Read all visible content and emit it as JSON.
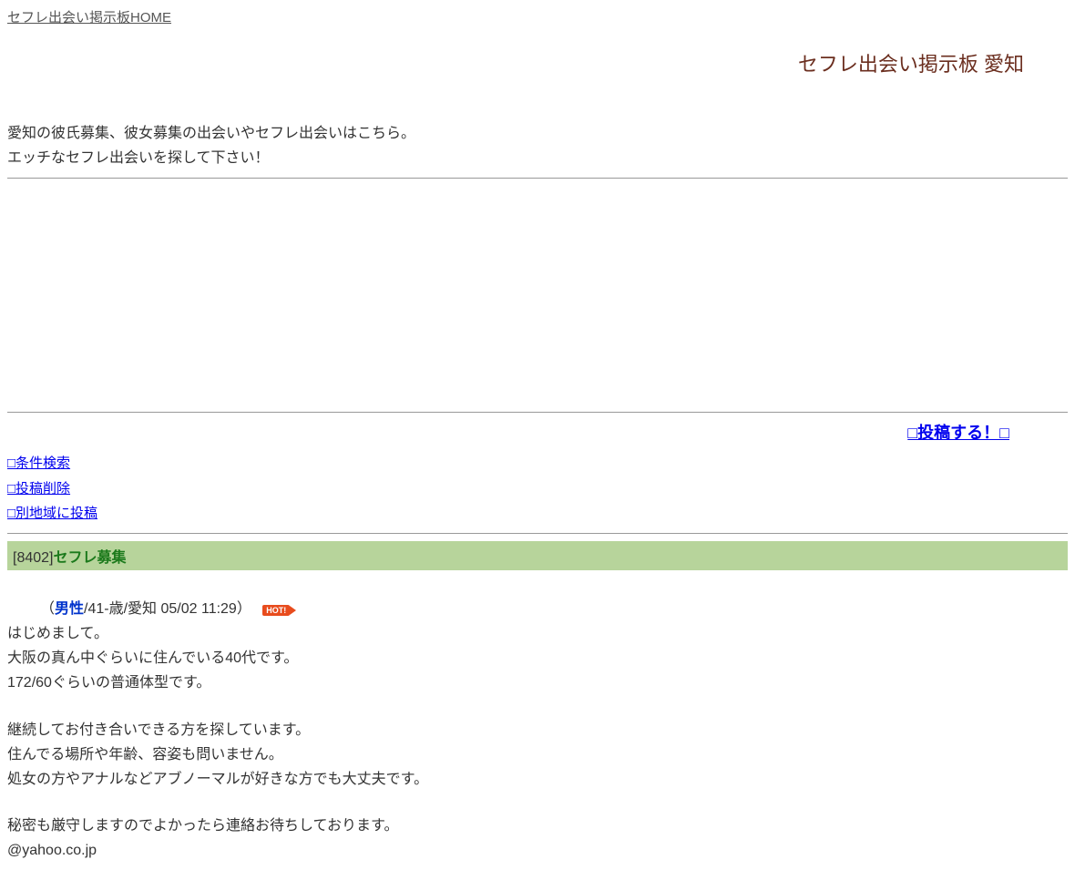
{
  "homeLink": "セフレ出会い掲示板HOME",
  "pageTitle": "セフレ出会い掲示板 愛知",
  "introLine1": "愛知の彼氏募集、彼女募集の出会いやセフレ出会いはこちら。",
  "introLine2": "エッチなセフレ出会いを探して下さい！",
  "postLink": "□投稿する！□",
  "sideLinks": {
    "search": "□条件検索",
    "delete": "□投稿削除",
    "otherRegion": "□別地域に投稿"
  },
  "thread": {
    "id": "[8402]",
    "title": "セフレ募集",
    "metaOpen": "（",
    "gender": "男性",
    "metaRest": "/41-歳/愛知 05/02 11:29）",
    "hotLabel": "HOT!",
    "line1": "はじめまして。",
    "line2": "大阪の真ん中ぐらいに住んでいる40代です。",
    "line3": "172/60ぐらいの普通体型です。",
    "line4": "継続してお付き合いできる方を探しています。",
    "line5": "住んでる場所や年齢、容姿も問いません。",
    "line6": "処女の方やアナルなどアブノーマルが好きな方でも大丈夫です。",
    "line7": "秘密も厳守しますのでよかったら連絡お待ちしております。",
    "email": "@yahoo.co.jp"
  }
}
